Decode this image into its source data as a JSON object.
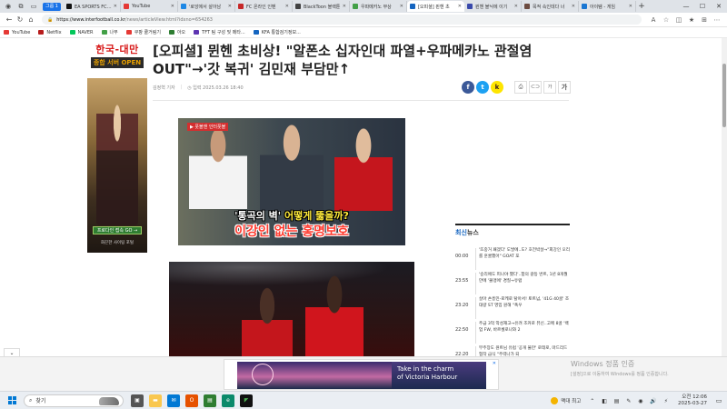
{
  "tabbar": {
    "group_label": "그룹 1",
    "tabs": [
      {
        "label": "EA SPORTS FC 온",
        "color": "#111111",
        "active": false
      },
      {
        "label": "YouTube",
        "color": "#e53935",
        "active": false
      },
      {
        "label": "'로앙에서 살아남",
        "color": "#1e88e5",
        "active": false
      },
      {
        "label": "FC 온라인 인벤",
        "color": "#c62828",
        "active": false
      },
      {
        "label": "BlackToon 블랙툰",
        "color": "#424242",
        "active": false
      },
      {
        "label": "우파메카노 부상",
        "color": "#43a047",
        "active": false
      },
      {
        "label": "[오피셜] 뮌헨 초",
        "color": "#1565c0",
        "active": true
      },
      {
        "label": "뮌헨 블닉에 이기",
        "color": "#3949ab",
        "active": false
      },
      {
        "label": "목적 속인데다 너",
        "color": "#6d4c41",
        "active": false
      },
      {
        "label": "아이템 - 게임",
        "color": "#1976d2",
        "active": false
      }
    ],
    "new_tab": "+"
  },
  "window": {
    "minimize": "—",
    "maximize": "☐",
    "close": "✕"
  },
  "address": {
    "host": "https://www.interfootball.co.kr",
    "path": "/news/articleView.html?idxno=654263"
  },
  "bookmarks": [
    {
      "label": "YouTube",
      "color": "#e53935"
    },
    {
      "label": "Netflix",
      "color": "#b71c1c"
    },
    {
      "label": "NAVER",
      "color": "#03c75a"
    },
    {
      "label": "나무",
      "color": "#43a047"
    },
    {
      "label": "쿠팡 쿨거림기",
      "color": "#e53935"
    },
    {
      "label": "아오",
      "color": "#2e7d32"
    },
    {
      "label": "TFT 팀 구성 및 메타...",
      "color": "#5e35b1"
    },
    {
      "label": "KFA 통합검기정보...",
      "color": "#1565c0"
    }
  ],
  "banner": {
    "line1": "한국-대만",
    "line2": "종합 서버 OPEN"
  },
  "side_ad": {
    "button": "프로다인 접속 GO →",
    "footer": "화끈한 사이팅 포털"
  },
  "article": {
    "headline": "[오피셜] 뮌헨 초비상! \"알폰소 십자인대 파열+우파메카노 관절염 OUT\"→'갓 복귀' 김민재 부담만↑",
    "author": "김정혁 기자",
    "date": "◷ 입력 2025.03.26 18:40",
    "tools": {
      "print": "⎙",
      "link": "⊂⊃",
      "font_small": "가",
      "font_big": "가"
    },
    "image1": {
      "badge": "▶ 풋볼앤 인터풋볼",
      "caption_pre": "'통곡의 벽' ",
      "caption_mid": "어떻게 뚫을까?",
      "caption_hl": "이강인 없는 홍명보호"
    }
  },
  "share": {
    "facebook": "f",
    "twitter": "t",
    "kakao": "k"
  },
  "colors": {
    "facebook": "#3b5998",
    "twitter": "#1da1f2",
    "kakao": "#fee500"
  },
  "news": {
    "title_accent": "최신",
    "title_rest": "뉴스",
    "items": [
      {
        "time": "00:00",
        "text": "'뜨중거 패겠다' 도발에..도? 호전박살→\"회강인 오리를 훈쿨했어\" GOAT 포"
      },
      {
        "time": "23:55",
        "text": "'승리에도 피나야 했다'..합의 갈등 번트, 1년 8개월 만에 '몰앵에' 경질→유럽"
      },
      {
        "time": "23:20",
        "text": "살아 손흥민-로케로 탈아서! 토트넘, '41G 40골' 조대량 ST 영입 원해 \"폭우"
      },
      {
        "time": "22:50",
        "text": "주급 3억 악성재고→유려 조커로 뷰신..고메 8골 '백업 FW, 바르셀로나와 2"
      },
      {
        "time": "22:20",
        "text": "부주장도 원트님 유럽 '공개 불만' 로테로, 마드리드 협작 급식 \"주력나가 되"
      }
    ]
  },
  "bottom_ad": {
    "text_line1": "Take in the charm",
    "text_line2": "of Victoria Harbour",
    "close": "✕",
    "collapse": "⌄"
  },
  "watermark": {
    "line1": "Windows 정품 인증",
    "line2": "[설정]으로 이동하여 Windows를 정품 인증합니다."
  },
  "taskbar": {
    "search": "찾기",
    "weather": "맥대 최고",
    "time": "오전 12:06",
    "date": "2025-03-27"
  }
}
